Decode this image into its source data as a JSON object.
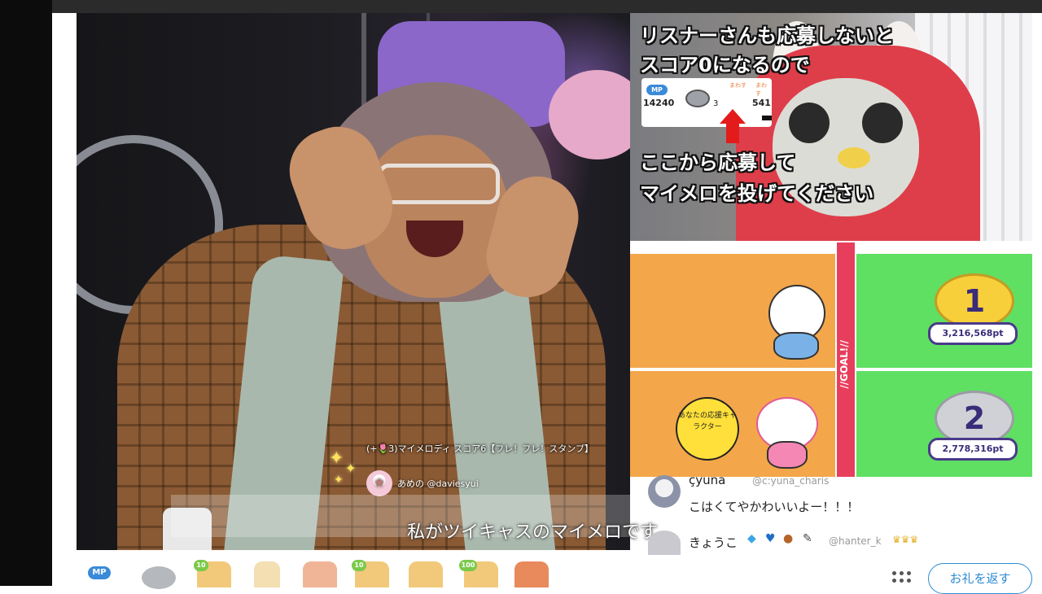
{
  "main_video": {
    "gift_message": "(+🌷3)マイメロディ スコア6【フレ！フレ！スタンプ】",
    "gift_user": "あめの @daviesyui",
    "subtitle": "私がツイキャスのマイメロです"
  },
  "info_panel": {
    "line1": "リスナーさんも応募しないと",
    "line2": "スコア0になるので",
    "line3": "ここから応募して",
    "line4": "マイメロを投げてください",
    "mini": {
      "mp_label": "MP",
      "mp_value": "14240",
      "coin_count": "3",
      "tag1": "まわす",
      "tag2": "まわす",
      "right_value": "541"
    }
  },
  "goal_panel": {
    "goal_label": "//GOAL!//",
    "cheer_badge": "あなたの応援キャラクター",
    "ranks": [
      {
        "rank": "1",
        "score": "3,216,568pt"
      },
      {
        "rank": "2",
        "score": "2,778,316pt"
      }
    ]
  },
  "comments": [
    {
      "name": "çyuna",
      "handle": "@c:yuna_charis",
      "text": "こはくてやかわいいよー！！！"
    },
    {
      "name": "きょうこ",
      "handle": "@hanter_k",
      "text": ""
    }
  ],
  "toolbar": {
    "mp_label": "MP",
    "stamp_counts": [
      "10",
      "10",
      "100"
    ],
    "thanks_button": "お礼を返す"
  },
  "colors": {
    "accent_blue": "#2d8bd3",
    "lane_orange": "#f3a64a",
    "lane_green": "#5fe063",
    "goal_pink": "#e83e5d"
  }
}
